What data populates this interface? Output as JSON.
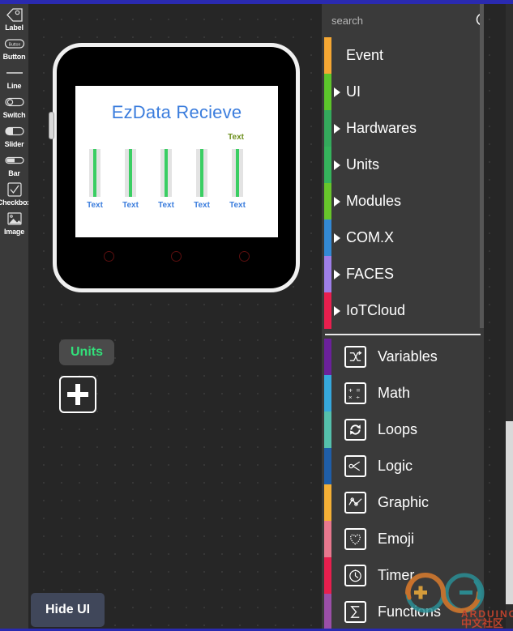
{
  "app": {
    "accent_top_bar": "#2a2ab0",
    "panel_bg": "#3a3a3a",
    "canvas_bg": "#262626"
  },
  "tool_sidebar": {
    "items": [
      {
        "label": "Label",
        "icon": "tag-icon"
      },
      {
        "label": "Button",
        "icon": "button-icon"
      },
      {
        "label": "Line",
        "icon": "line-icon"
      },
      {
        "label": "Switch",
        "icon": "switch-icon"
      },
      {
        "label": "Slider",
        "icon": "slider-icon"
      },
      {
        "label": "Bar",
        "icon": "bar-icon"
      },
      {
        "label": "Checkbox",
        "icon": "checkbox-icon"
      },
      {
        "label": "Image",
        "icon": "image-icon"
      }
    ]
  },
  "canvas": {
    "device": {
      "screen_title": "EzData Recieve",
      "screen_title_color": "#3b7ddd",
      "caption": "Text",
      "caption_color": "#6d8f1d",
      "bars": [
        {
          "label": "Text",
          "value": 100
        },
        {
          "label": "Text",
          "value": 100
        },
        {
          "label": "Text",
          "value": 100
        },
        {
          "label": "Text",
          "value": 100
        },
        {
          "label": "Text",
          "value": 100
        }
      ],
      "bar_fill_color": "#3ace63",
      "bar_track_color": "#e3e3e3",
      "hardware_buttons": 3
    },
    "units_chip": {
      "label": "Units",
      "color": "#32e07a"
    },
    "add_button": {
      "label": "+"
    },
    "hide_ui_button": {
      "label": "Hide UI"
    }
  },
  "palette": {
    "search": {
      "placeholder": "search",
      "value": ""
    },
    "categories": [
      {
        "label": "Event",
        "color": "#f5a733",
        "expandable": false
      },
      {
        "label": "UI",
        "color": "#5cc52b",
        "expandable": true
      },
      {
        "label": "Hardwares",
        "color": "#34a95c",
        "expandable": true
      },
      {
        "label": "Units",
        "color": "#35b35c",
        "expandable": true
      },
      {
        "label": "Modules",
        "color": "#67c52b",
        "expandable": true
      },
      {
        "label": "COM.X",
        "color": "#3389d4",
        "expandable": true
      },
      {
        "label": "FACES",
        "color": "#9e7fe8",
        "expandable": true
      },
      {
        "label": "IoTCloud",
        "color": "#e81f4e",
        "expandable": true
      }
    ],
    "blocks": [
      {
        "label": "Variables",
        "color": "#6b219b",
        "icon": "variables-icon"
      },
      {
        "label": "Math",
        "color": "#36a8dd",
        "icon": "math-icon"
      },
      {
        "label": "Loops",
        "color": "#55c0ac",
        "icon": "loops-icon"
      },
      {
        "label": "Logic",
        "color": "#1f5ea8",
        "icon": "logic-icon"
      },
      {
        "label": "Graphic",
        "color": "#f5b036",
        "icon": "graphic-icon"
      },
      {
        "label": "Emoji",
        "color": "#e8788e",
        "icon": "emoji-icon"
      },
      {
        "label": "Timer",
        "color": "#e81f4e",
        "icon": "timer-icon"
      },
      {
        "label": "Functions",
        "color": "#9b4fa8",
        "icon": "functions-icon"
      }
    ]
  },
  "watermark": {
    "title": "ARDUINO",
    "subtitle": "中文社区"
  }
}
